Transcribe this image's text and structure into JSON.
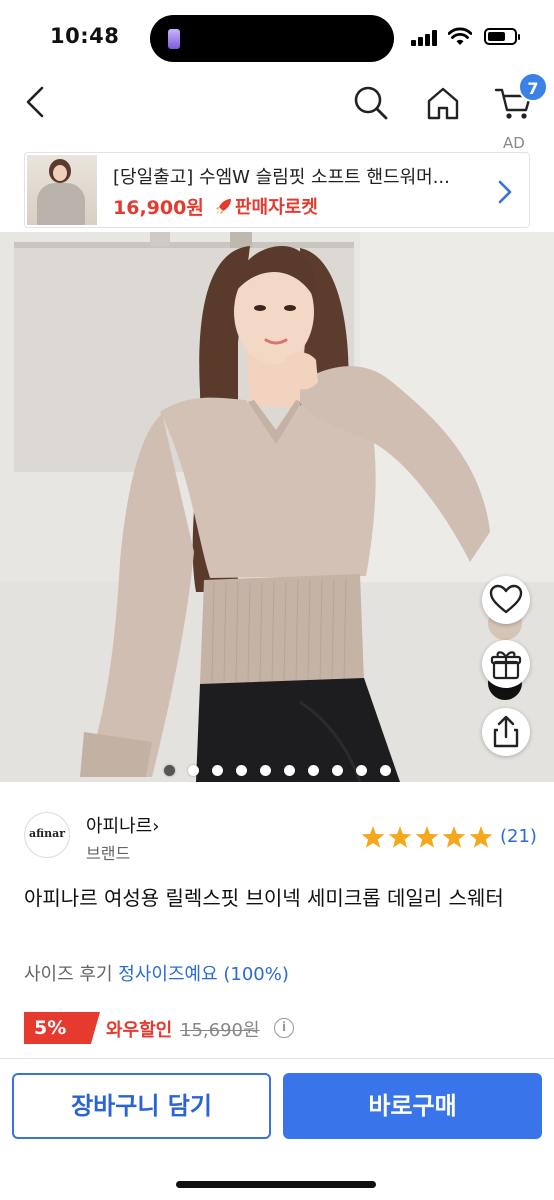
{
  "status_bar": {
    "time": "10:48"
  },
  "nav": {
    "cart_count": "7",
    "ad_label": "AD"
  },
  "banner": {
    "title": "[당일출고] 수엠W 슬림핏 소프트 핸드워머...",
    "price": "16,900원",
    "delivery": "판매자로켓"
  },
  "product": {
    "brand_name": "아피나르",
    "brand_chevron": "›",
    "brand_label": "브랜드",
    "brand_logo_text": "afinar",
    "rating_stars": 5,
    "rating_count": "(21)",
    "title": "아피나르 여성용 릴렉스핏 브이넥 세미크롭 데일리 스웨터",
    "size_review_label": "사이즈 후기",
    "size_review_value": "정사이즈예요 (100%)",
    "discount_percent": "5%",
    "discount_label": "와우할인",
    "original_price": "15,690원",
    "info_symbol": "i"
  },
  "gallery": {
    "image_count": 10,
    "active_index": 0
  },
  "actions": {
    "add_to_cart": "장바구니 담기",
    "buy_now": "바로구매"
  },
  "colors": {
    "accent_blue": "#3a74ea",
    "sale_red": "#e63a2e"
  }
}
